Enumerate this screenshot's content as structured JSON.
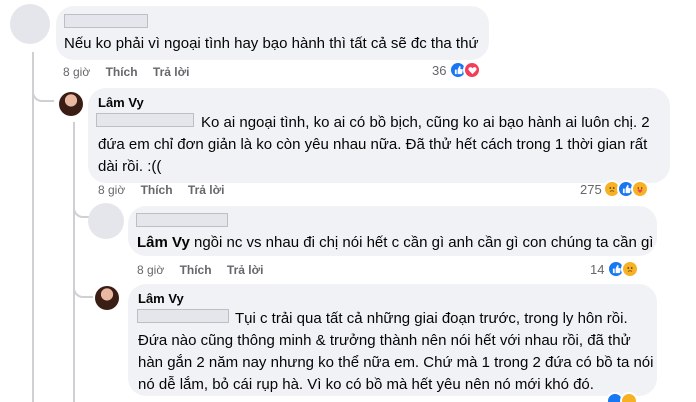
{
  "comment1": {
    "text": "Nếu ko phải vì ngoại tình hay bạo hành thì tất cả sẽ đc tha thứ",
    "time": "8 giờ",
    "like_label": "Thích",
    "reply_label": "Trả lời",
    "reaction_count": "36",
    "reactions": [
      "like-icon",
      "love-icon"
    ]
  },
  "reply1": {
    "author": "Lâm Vy",
    "text_line1": "Ko ai ngoại tình, ko ai có bồ bịch, cũng ko ai bạo hành ai luôn chị. 2",
    "text_line2": "đứa em chỉ đơn giản là ko còn yêu nhau nữa. Đã thử hết cách trong 1 thời gian rất",
    "text_line3": "dài rồi. :((",
    "time": "8 giờ",
    "like_label": "Thích",
    "reply_label": "Trả lời",
    "reaction_count": "275",
    "reactions": [
      "sad-icon",
      "like-icon",
      "care-icon"
    ]
  },
  "reply2": {
    "mention": "Lâm Vy",
    "text": " ngồi nc vs nhau đi chị nói hết c cần gì anh cần gì con chúng ta cần gì",
    "time": "8 giờ",
    "like_label": "Thích",
    "reply_label": "Trả lời",
    "reaction_count": "14",
    "reactions": [
      "like-icon",
      "sad-icon"
    ]
  },
  "reply3": {
    "author": "Lâm Vy",
    "text_line1": "Tụi c trải qua tất cả những giai đoạn trước, trong ly hôn rồi.",
    "text_line2": "Đứa nào cũng thông minh & trưởng thành nên nói hết với nhau rồi, đã thử",
    "text_line3": "hàn gắn 2 năm nay nhưng ko thể nữa em. Chứ mà 1 trong 2 đứa có bồ ta nói",
    "text_line4": "nó dễ lắm, bỏ cái rụp hà. Vì ko có bồ mà hết yêu nên nó mới khó đó."
  },
  "colors": {
    "bubble": "#f0f2f5",
    "meta": "#65676b",
    "like": "#1877f2",
    "love": "#f33e58",
    "sad": "#f7b125",
    "thread": "#ced0d4"
  }
}
